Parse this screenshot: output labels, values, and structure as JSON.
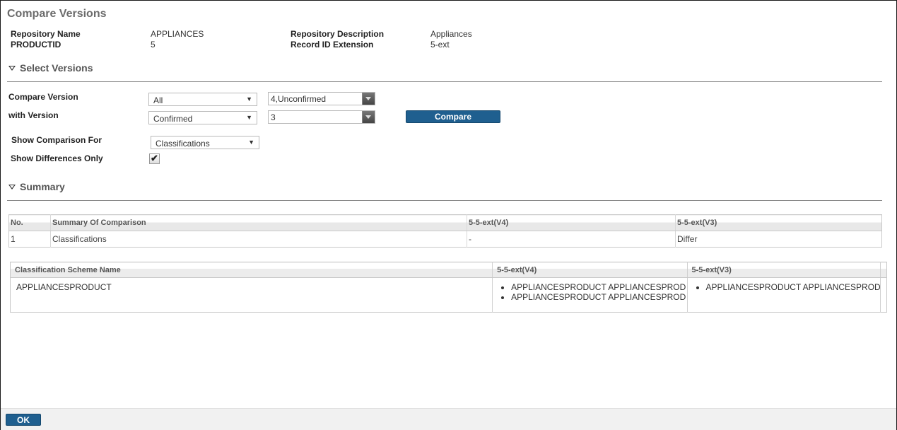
{
  "dialog": {
    "title": "Compare Versions"
  },
  "header": {
    "repository_name_label": "Repository Name",
    "repository_name_value": "APPLIANCES",
    "productid_label": "PRODUCTID",
    "productid_value": "5",
    "repository_description_label": "Repository Description",
    "repository_description_value": "Appliances",
    "record_id_extension_label": "Record ID Extension",
    "record_id_extension_value": "5-ext"
  },
  "select_versions": {
    "section_title": "Select Versions",
    "compare_version_label": "Compare Version",
    "compare_version_filter": "All",
    "compare_version_value": "4,Unconfirmed",
    "with_version_label": "with Version",
    "with_version_filter": "Confirmed",
    "with_version_value": "3",
    "compare_button": "Compare",
    "show_comparison_for_label": "Show Comparison For",
    "show_comparison_for_value": "Classifications",
    "show_differences_only_label": "Show Differences Only",
    "show_differences_only_checked": true
  },
  "summary": {
    "section_title": "Summary",
    "columns": [
      "No.",
      "Summary Of Comparison",
      "5-5-ext(V4)",
      "5-5-ext(V3)"
    ],
    "rows": [
      [
        "1",
        "Classifications",
        "-",
        "Differ"
      ]
    ]
  },
  "classification_table": {
    "columns": [
      "Classification Scheme Name",
      "5-5-ext(V4)",
      "5-5-ext(V3)"
    ],
    "rows": [
      {
        "name": "APPLIANCESPRODUCT",
        "v4": [
          "APPLIANCESPRODUCT APPLIANCESPROD",
          "APPLIANCESPRODUCT APPLIANCESPROD"
        ],
        "v3": [
          "APPLIANCESPRODUCT APPLIANCESPROD"
        ]
      }
    ]
  },
  "footer": {
    "ok_button": "OK"
  }
}
